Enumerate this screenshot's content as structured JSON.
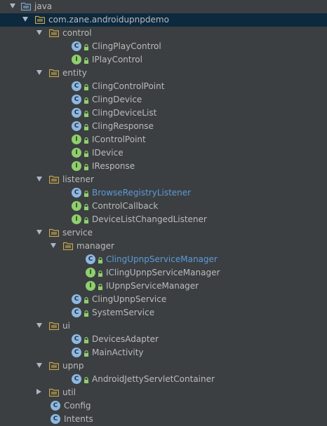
{
  "tree": [
    {
      "label": "java",
      "kind": "folder-blue",
      "expand": "down",
      "depth": 0
    },
    {
      "label": "com.zane.androidupnpdemo",
      "kind": "package",
      "expand": "down",
      "depth": 1,
      "selected": true
    },
    {
      "label": "control",
      "kind": "package",
      "expand": "down",
      "depth": 2
    },
    {
      "label": "ClingPlayControl",
      "kind": "class",
      "depth": 3
    },
    {
      "label": "IPlayControl",
      "kind": "interface",
      "depth": 3
    },
    {
      "label": "entity",
      "kind": "package",
      "expand": "down",
      "depth": 2
    },
    {
      "label": "ClingControlPoint",
      "kind": "class",
      "depth": 3
    },
    {
      "label": "ClingDevice",
      "kind": "class",
      "depth": 3
    },
    {
      "label": "ClingDeviceList",
      "kind": "class",
      "depth": 3
    },
    {
      "label": "ClingResponse",
      "kind": "class",
      "depth": 3
    },
    {
      "label": "IControlPoint",
      "kind": "interface",
      "depth": 3
    },
    {
      "label": "IDevice",
      "kind": "interface",
      "depth": 3
    },
    {
      "label": "IResponse",
      "kind": "interface",
      "depth": 3
    },
    {
      "label": "listener",
      "kind": "package",
      "expand": "down",
      "depth": 2
    },
    {
      "label": "BrowseRegistryListener",
      "kind": "class",
      "depth": 3,
      "highlight": true
    },
    {
      "label": "ControlCallback",
      "kind": "interface",
      "depth": 3
    },
    {
      "label": "DeviceListChangedListener",
      "kind": "interface",
      "depth": 3
    },
    {
      "label": "service",
      "kind": "package",
      "expand": "down",
      "depth": 2
    },
    {
      "label": "manager",
      "kind": "package",
      "expand": "down",
      "depth": 3
    },
    {
      "label": "ClingUpnpServiceManager",
      "kind": "class",
      "depth": 4,
      "highlight": true
    },
    {
      "label": "IClingUpnpServiceManager",
      "kind": "interface",
      "depth": 4
    },
    {
      "label": "IUpnpServiceManager",
      "kind": "interface",
      "depth": 4
    },
    {
      "label": "ClingUpnpService",
      "kind": "class",
      "depth": 3
    },
    {
      "label": "SystemService",
      "kind": "class",
      "depth": 3
    },
    {
      "label": "ui",
      "kind": "package",
      "expand": "down",
      "depth": 2
    },
    {
      "label": "DevicesAdapter",
      "kind": "class",
      "depth": 3
    },
    {
      "label": "MainActivity",
      "kind": "class",
      "depth": 3
    },
    {
      "label": "upnp",
      "kind": "package",
      "expand": "down",
      "depth": 2
    },
    {
      "label": "AndroidJettyServletContainer",
      "kind": "class",
      "depth": 3
    },
    {
      "label": "util",
      "kind": "package",
      "expand": "right",
      "depth": 2
    },
    {
      "label": "Config",
      "kind": "class-plain",
      "depth": 2
    },
    {
      "label": "Intents",
      "kind": "class-plain",
      "depth": 2
    }
  ],
  "colors": {
    "background": "#3c3f41",
    "selection": "#0d293e",
    "text": "#bbbbbb",
    "link": "#5c9bd8",
    "class_icon": "#8fb8e0",
    "interface_icon": "#8fcf6f",
    "folder": "#c8a64a",
    "folder_blue": "#7ea7d8"
  }
}
